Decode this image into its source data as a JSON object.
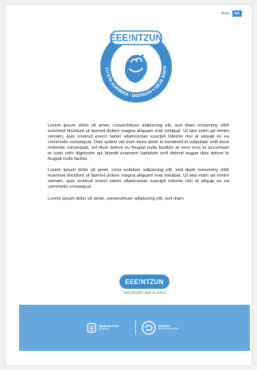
{
  "language_switcher": {
    "options": [
      "EUS",
      "ES"
    ],
    "active": "ES"
  },
  "logo": {
    "wordmark": "EEE!NTZUN",
    "ring_text": "SOZIOLU ETA AURRERA · DISFRUTA Y DEJA DISFRUTAR"
  },
  "body": {
    "paragraphs": [
      "Lorem ipsum dolor sit amet, consectetuer adipiscing elit, sed diam nonummy nibh euismod tincidunt ut laoreet dolore magna aliquam erat volutpat. Ut wisi enim ad minim veniam, quis nostrud exerci tation ullamcorper suscipit lobortis nisl ut aliquip ex ea commodo consequat. Duis autem vel eum iriure dolor in hendrerit in vulputate velit esse molestie consequat, vel illum dolore eu feugiat nulla facilisis at vero eros et accumsan et iusto odio dignissim qui blandit praesent luptatum zzril delenit augue duis dolore te feugait nulla facilisi.",
      "Lorem ipsum dolor sit amet, cons ectetuer adipiscing elit, sed diam nonummy nibh euismod tincidunt ut laoreet dolore magna aliquam erat volutpat. Ut wisi enim ad minim veniam, quis nostrud exerci tation ullamcorper suscipit lobortis nisl ut aliquip ex ea commodo consequat.",
      "Lorem ipsum dolor sit amet, consectetuer adipiscing elit, sed diam"
    ]
  },
  "cta": {
    "label": "EEE!NTZUN",
    "caption": "DESCÁRGATE AQUÍ EL AUDIO"
  },
  "footer": {
    "sponsor_left": {
      "line1": "Diputación Foral",
      "line2": "de Bizkaia"
    },
    "sponsor_right": {
      "line1": "EUSKADI",
      "line2": "BASQUE COUNTRY"
    }
  },
  "colors": {
    "brand_blue": "#3f8ccd",
    "footer_blue": "#66a9df"
  }
}
